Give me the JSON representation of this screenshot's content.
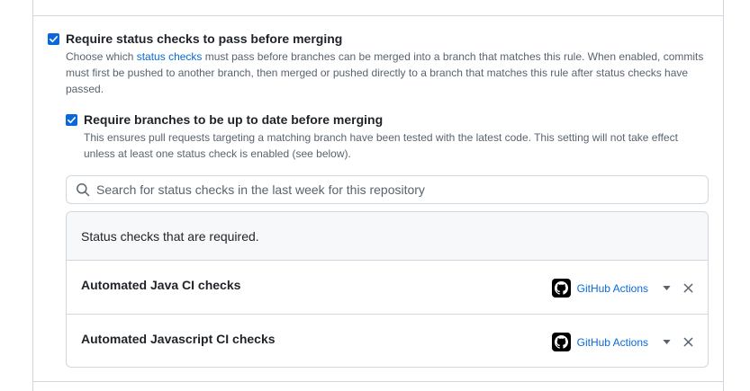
{
  "status_checks": {
    "enabled": true,
    "label": "Require status checks to pass before merging",
    "desc_prefix": "Choose which ",
    "desc_link": "status checks",
    "desc_line1_rest": " must pass before branches can be merged into a branch that matches this rule. When enabled, commits",
    "desc_line2": "must first be pushed to another branch, then merged or pushed directly to a branch that matches this rule after status checks have",
    "desc_line3": "passed."
  },
  "up_to_date": {
    "enabled": true,
    "label": "Require branches to be up to date before merging",
    "desc_line1": "This ensures pull requests targeting a matching branch have been tested with the latest code. This setting will not take effect",
    "desc_line2": "unless at least one status check is enabled (see below)."
  },
  "search": {
    "placeholder": "Search for status checks in the last week for this repository",
    "value": ""
  },
  "required_checks": {
    "header": "Status checks that are required.",
    "items": [
      {
        "name": "Automated Java CI checks",
        "app": "GitHub Actions",
        "app_icon": "github-logo-icon"
      },
      {
        "name": "Automated Javascript CI checks",
        "app": "GitHub Actions",
        "app_icon": "github-logo-icon"
      }
    ]
  },
  "colors": {
    "accent": "#0969da",
    "border": "#d0d7de",
    "muted": "#59636e"
  }
}
